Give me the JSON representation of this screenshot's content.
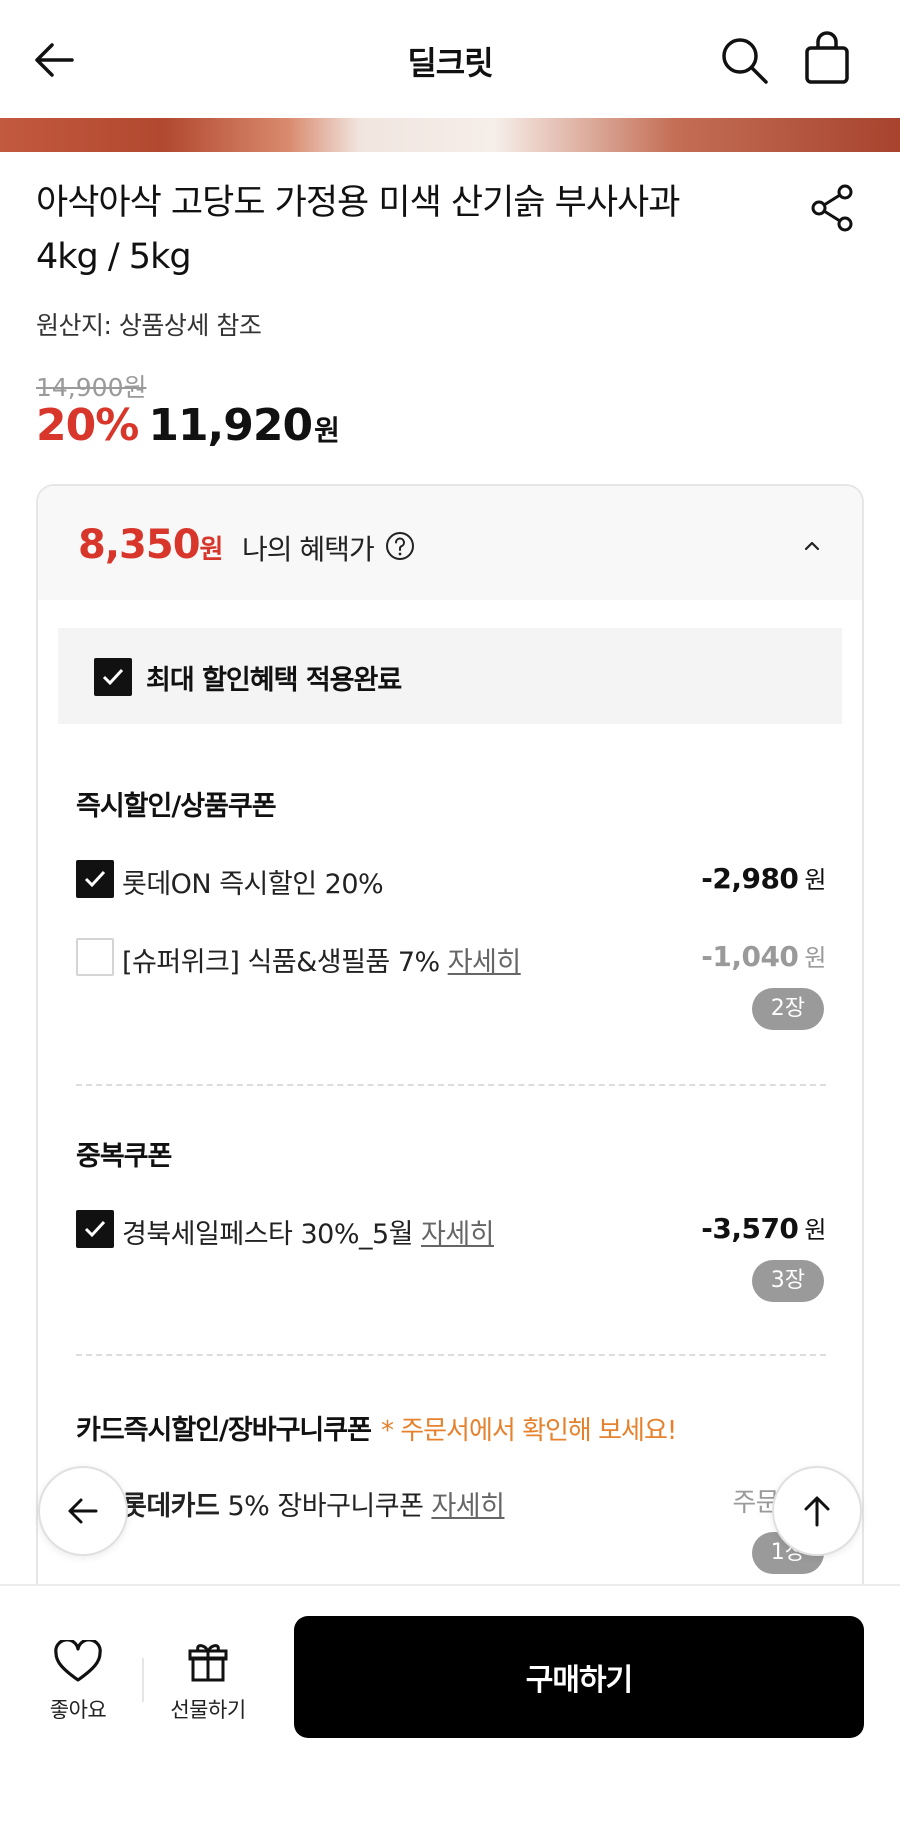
{
  "header": {
    "title": "딜크릿",
    "back_icon": "arrow-left-icon",
    "search_icon": "search-icon",
    "cart_icon": "shopping-bag-icon"
  },
  "product": {
    "title_line1": "아삭아삭 고당도 가정용 미색 산기슭 부사사과",
    "title_line2": "4kg / 5kg",
    "origin": "원산지: 상품상세 참조",
    "original_price": "14,900원",
    "discount_rate": "20%",
    "price": "11,920",
    "price_unit": "원"
  },
  "benefit": {
    "price": "8,350",
    "price_unit": "원",
    "label": "나의 혜택가",
    "max_applied_label": "최대 할인혜택 적용완료",
    "sections": {
      "instant": {
        "title": "즉시할인/상품쿠폰",
        "items": [
          {
            "label": "롯데ON 즉시할인 20%",
            "amount": "-2,980",
            "unit": "원",
            "checked": true
          },
          {
            "label": "[슈퍼위크] 식품&생필품 7%",
            "detail": "자세히",
            "amount": "-1,040",
            "unit": "원",
            "count": "2장",
            "checked": false
          }
        ]
      },
      "duplicate": {
        "title": "중복쿠폰",
        "items": [
          {
            "label": "경북세일페스타 30%_5월",
            "detail": "자세히",
            "amount": "-3,570",
            "unit": "원",
            "count": "3장",
            "checked": true
          }
        ]
      },
      "card": {
        "title": "카드즉시할인/장바구니쿠폰",
        "note": "* 주문서에서 확인해 보세요!",
        "items": [
          {
            "label_bold": "롯데카드",
            "label": "5% 장바구니쿠폰",
            "detail": "자세히",
            "amount_note": "주문금액",
            "count": "1장"
          }
        ]
      }
    }
  },
  "bottom": {
    "like_label": "좋아요",
    "gift_label": "선물하기",
    "buy_label": "구매하기"
  },
  "colors": {
    "accent_red": "#d9362b",
    "note_orange": "#e6822d",
    "buy_button": "#000000"
  }
}
